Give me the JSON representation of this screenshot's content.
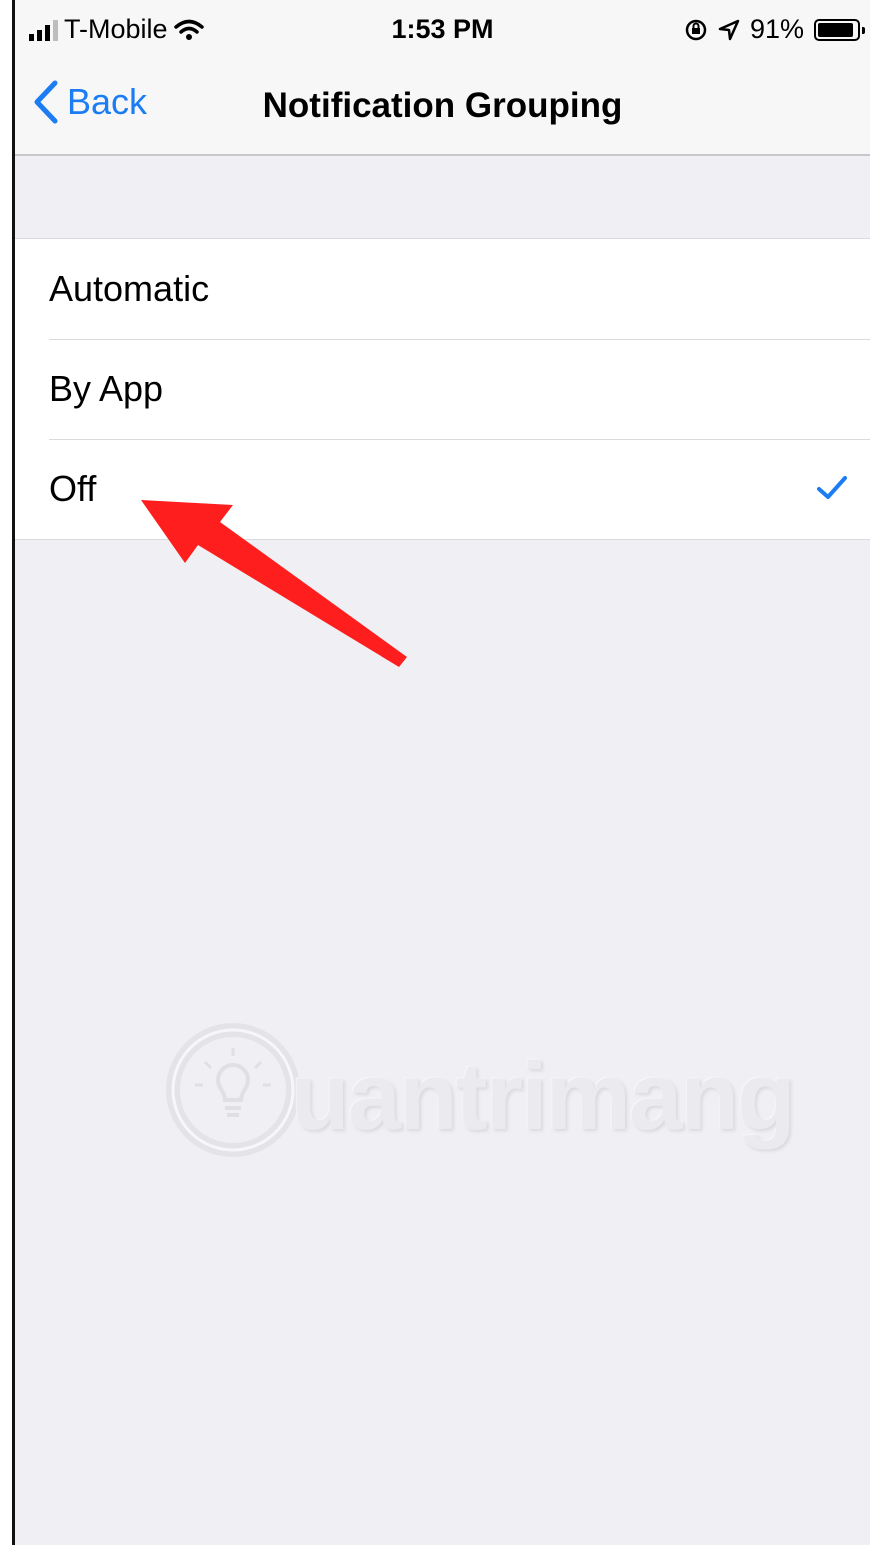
{
  "status_bar": {
    "carrier": "T-Mobile",
    "time": "1:53 PM",
    "battery_percent": "91%",
    "battery_level": 0.91,
    "icons": [
      "signal-icon",
      "wifi-icon",
      "orientation-lock-icon",
      "location-icon",
      "battery-icon"
    ]
  },
  "nav": {
    "back_label": "Back",
    "title": "Notification Grouping"
  },
  "options": [
    {
      "label": "Automatic",
      "selected": false
    },
    {
      "label": "By App",
      "selected": false
    },
    {
      "label": "Off",
      "selected": true
    }
  ],
  "watermark": {
    "text": "uantrimang",
    "logo": "Quantrimang"
  },
  "colors": {
    "accent": "#1c7cf4",
    "background": "#efeff4",
    "annotation_arrow": "#ff1e1e"
  }
}
